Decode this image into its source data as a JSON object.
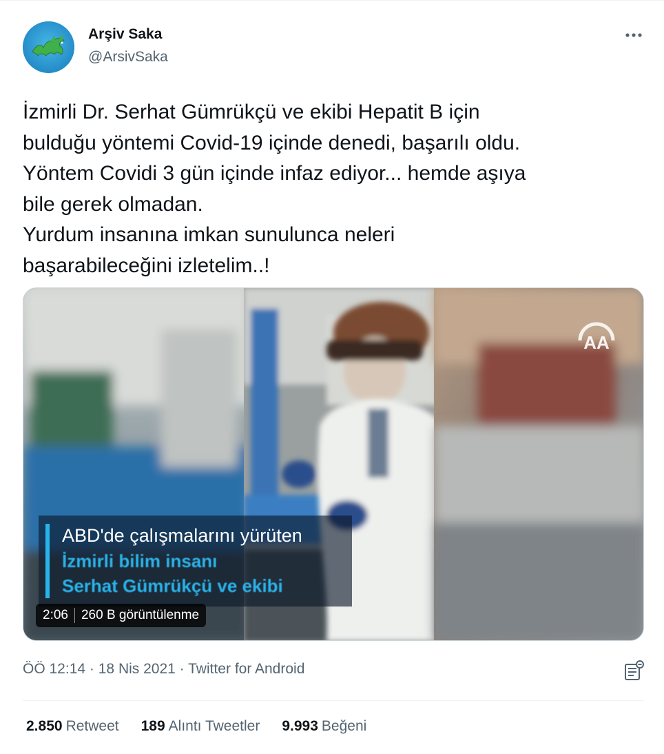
{
  "user": {
    "name": "Arşiv Saka",
    "handle": "@ArsivSaka"
  },
  "tweet": {
    "text": "İzmirli Dr. Serhat Gümrükçü ve ekibi Hepatit B için\nbulduğu yöntemi Covid-19 içinde denedi, başarılı oldu.\nYöntem Covidi 3 gün içinde infaz ediyor... hemde aşıya\nbile gerek olmadan.\nYurdum insanına imkan sunulunca neleri\nbaşarabileceğini izletelim..!"
  },
  "video": {
    "caption_line1": "ABD'de çalışmalarını yürüten",
    "caption_line2": "İzmirli bilim insanı",
    "caption_line3": "Serhat Gümrükçü ve ekibi",
    "duration": "2:06",
    "views": "260 B görüntülenme",
    "watermark": "AA"
  },
  "meta": {
    "time": "ÖÖ 12:14",
    "date": "18 Nis 2021",
    "source": "Twitter for Android",
    "separator": "·"
  },
  "stats": [
    {
      "count": "2.850",
      "label": "Retweet"
    },
    {
      "count": "189",
      "label": "Alıntı Tweetler"
    },
    {
      "count": "9.993",
      "label": "Beğeni"
    }
  ],
  "colors": {
    "text_primary": "#0f1419",
    "text_secondary": "#536471",
    "caption_accent": "#2ab3ea",
    "avatar_bg": "#2f9fd6"
  },
  "icons": {
    "more": "more-dots-icon",
    "analytics": "analytics-icon"
  }
}
